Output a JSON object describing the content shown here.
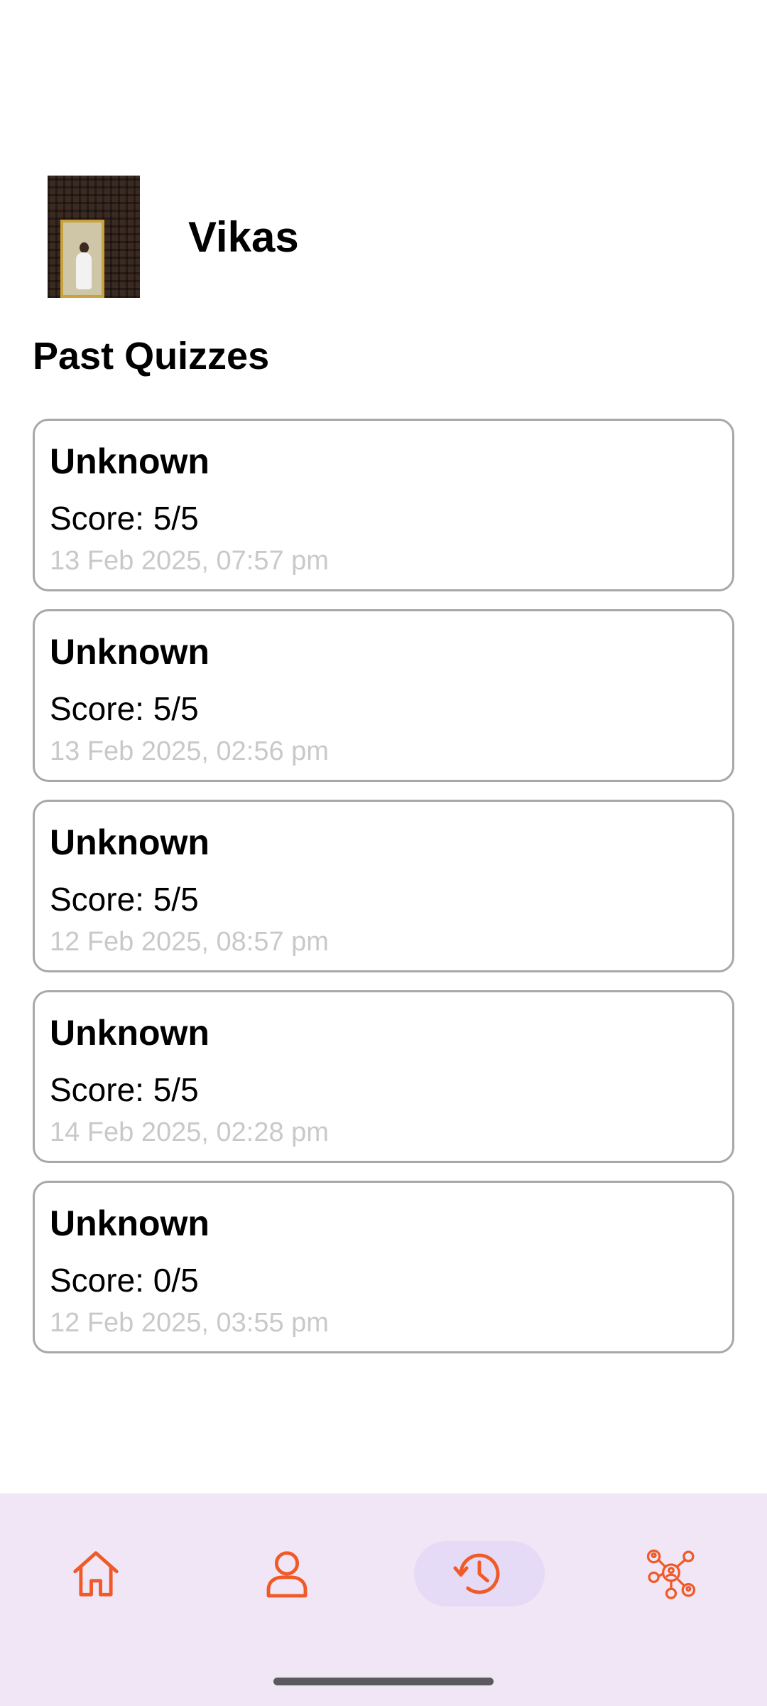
{
  "profile": {
    "name": "Vikas"
  },
  "section_title": "Past Quizzes",
  "quizzes": [
    {
      "title": "Unknown",
      "score": "Score: 5/5",
      "date": "13 Feb 2025, 07:57 pm"
    },
    {
      "title": "Unknown",
      "score": "Score: 5/5",
      "date": "13 Feb 2025, 02:56 pm"
    },
    {
      "title": "Unknown",
      "score": "Score: 5/5",
      "date": "12 Feb 2025, 08:57 pm"
    },
    {
      "title": "Unknown",
      "score": "Score: 5/5",
      "date": "14 Feb 2025, 02:28 pm"
    },
    {
      "title": "Unknown",
      "score": "Score: 0/5",
      "date": "12 Feb 2025, 03:55 pm"
    }
  ],
  "bottom_nav": {
    "items": [
      {
        "icon": "home-icon",
        "active": false
      },
      {
        "icon": "profile-icon",
        "active": false
      },
      {
        "icon": "history-icon",
        "active": true
      },
      {
        "icon": "network-icon",
        "active": false
      }
    ]
  },
  "colors": {
    "accent": "#f05a28",
    "nav_background": "#f1e6f6",
    "nav_active_pill": "#e6dbf6",
    "card_border": "#a8a8a8",
    "date_text": "#c9c9c9"
  }
}
